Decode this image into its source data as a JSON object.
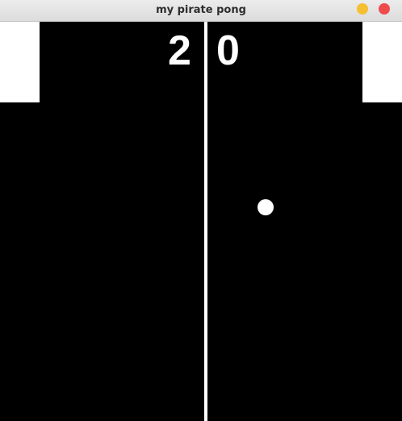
{
  "window": {
    "title": "my pirate pong",
    "minimize_color": "#f5bf32",
    "close_color": "#ee4c4c"
  },
  "game": {
    "left_score": "2",
    "right_score": "0"
  },
  "icons": {
    "minimize": "minimize-icon",
    "close": "close-icon"
  }
}
